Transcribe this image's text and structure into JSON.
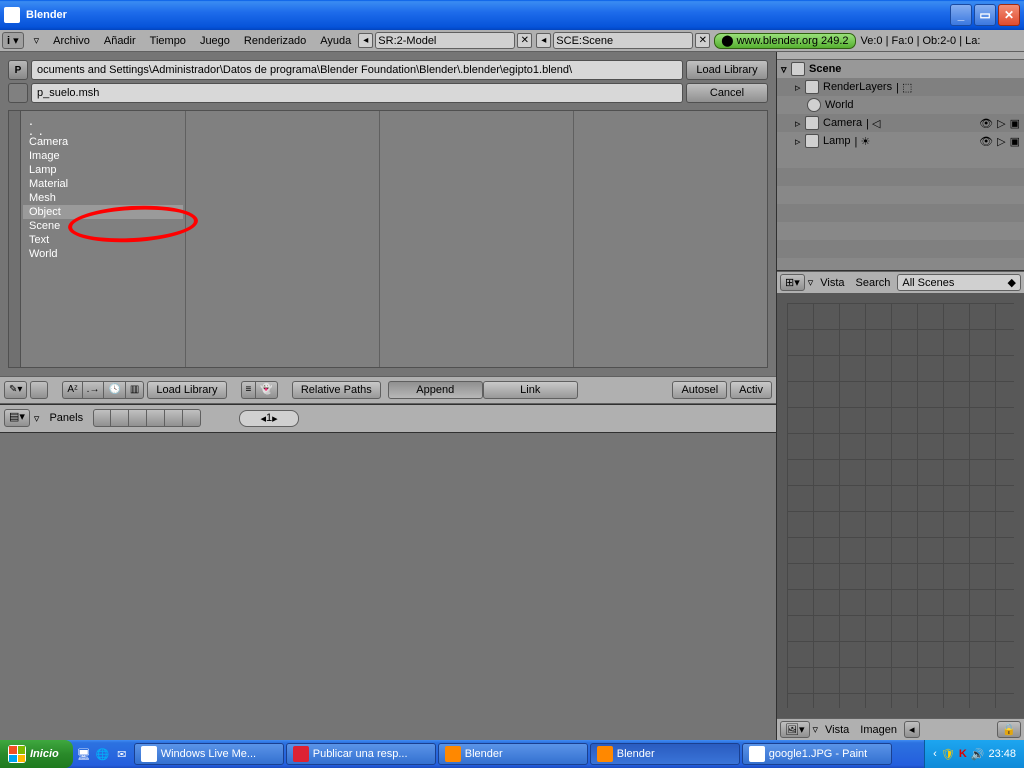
{
  "titlebar": {
    "title": "Blender"
  },
  "menubar": {
    "items": [
      "Archivo",
      "Añadir",
      "Tiempo",
      "Juego",
      "Renderizado",
      "Ayuda"
    ],
    "screen": "SR:2-Model",
    "scene": "SCE:Scene",
    "url": "www.blender.org",
    "version": "249.2",
    "stats": "Ve:0 | Fa:0 | Ob:2-0 | La:"
  },
  "filebrowser": {
    "path": "ocuments and Settings\\Administrador\\Datos de programa\\Blender Foundation\\Blender\\.blender\\egipto1.blend\\",
    "filename": "p_suelo.msh",
    "load": "Load Library",
    "cancel": "Cancel",
    "list": [
      ".",
      "..",
      "Camera",
      "Image",
      "Lamp",
      "Material",
      "Mesh",
      "Object",
      "Scene",
      "Text",
      "World"
    ],
    "selected_index": 7
  },
  "fbfoot": {
    "loadlib": "Load Library",
    "relpaths": "Relative Paths",
    "append": "Append",
    "link": "Link",
    "autosel": "Autosel",
    "active": "Activ"
  },
  "panels": {
    "label": "Panels",
    "num": "1"
  },
  "outliner": {
    "scene": "Scene",
    "renderlayers": "RenderLayers",
    "world": "World",
    "camera": "Camera",
    "lamp": "Lamp",
    "vista": "Vista",
    "search": "Search",
    "mode": "All Scenes"
  },
  "uvfoot": {
    "vista": "Vista",
    "imagen": "Imagen"
  },
  "taskbar": {
    "start": "Inicio",
    "items": [
      "Windows Live Me...",
      "Publicar una resp...",
      "Blender",
      "Blender",
      "google1.JPG - Paint"
    ],
    "clock": "23:48"
  }
}
